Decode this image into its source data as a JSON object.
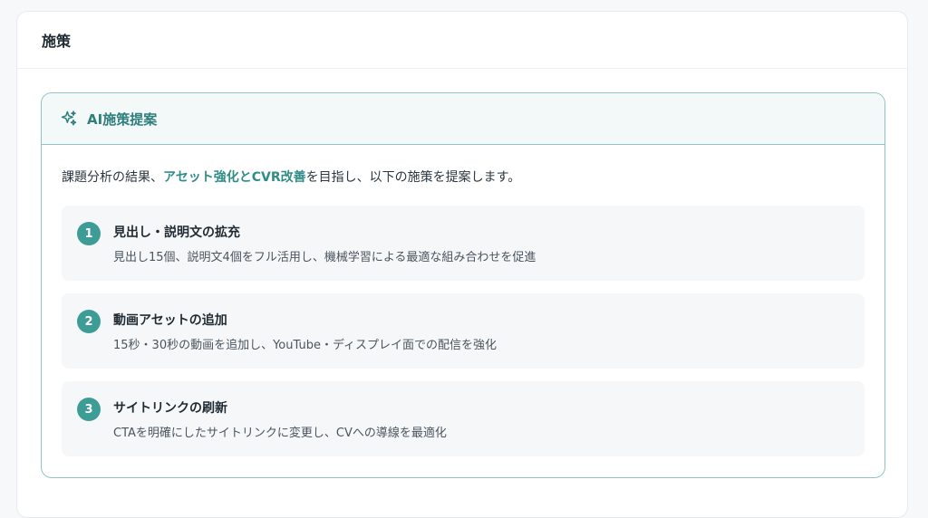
{
  "section": {
    "title": "施策"
  },
  "ai_panel": {
    "title": "AI施策提案",
    "icon": "sparkle-icon",
    "accent_color": "#3e9c97",
    "intro": {
      "prefix": "課題分析の結果、",
      "highlight": "アセット強化とCVR改善",
      "suffix": "を目指し、以下の施策を提案します。"
    },
    "items": [
      {
        "number": "1",
        "title": "見出し・説明文の拡充",
        "description": "見出し15個、説明文4個をフル活用し、機械学習による最適な組み合わせを促進"
      },
      {
        "number": "2",
        "title": "動画アセットの追加",
        "description": "15秒・30秒の動画を追加し、YouTube・ディスプレイ面での配信を強化"
      },
      {
        "number": "3",
        "title": "サイトリンクの刷新",
        "description": "CTAを明確にしたサイトリンクに変更し、CVへの導線を最適化"
      }
    ]
  }
}
